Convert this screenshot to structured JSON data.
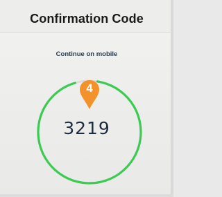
{
  "header": {
    "title": "Confirmation Code"
  },
  "instruction": {
    "text": "Continue on mobile"
  },
  "code": {
    "value": "3219",
    "timer_remaining_fraction": 0.93
  },
  "annotation": {
    "marker_label": "4"
  },
  "colors": {
    "timer_ring": "#3ccb52",
    "timer_track": "#dcdcdc",
    "marker": "#f3922b",
    "code_text": "#1e2c3f"
  }
}
